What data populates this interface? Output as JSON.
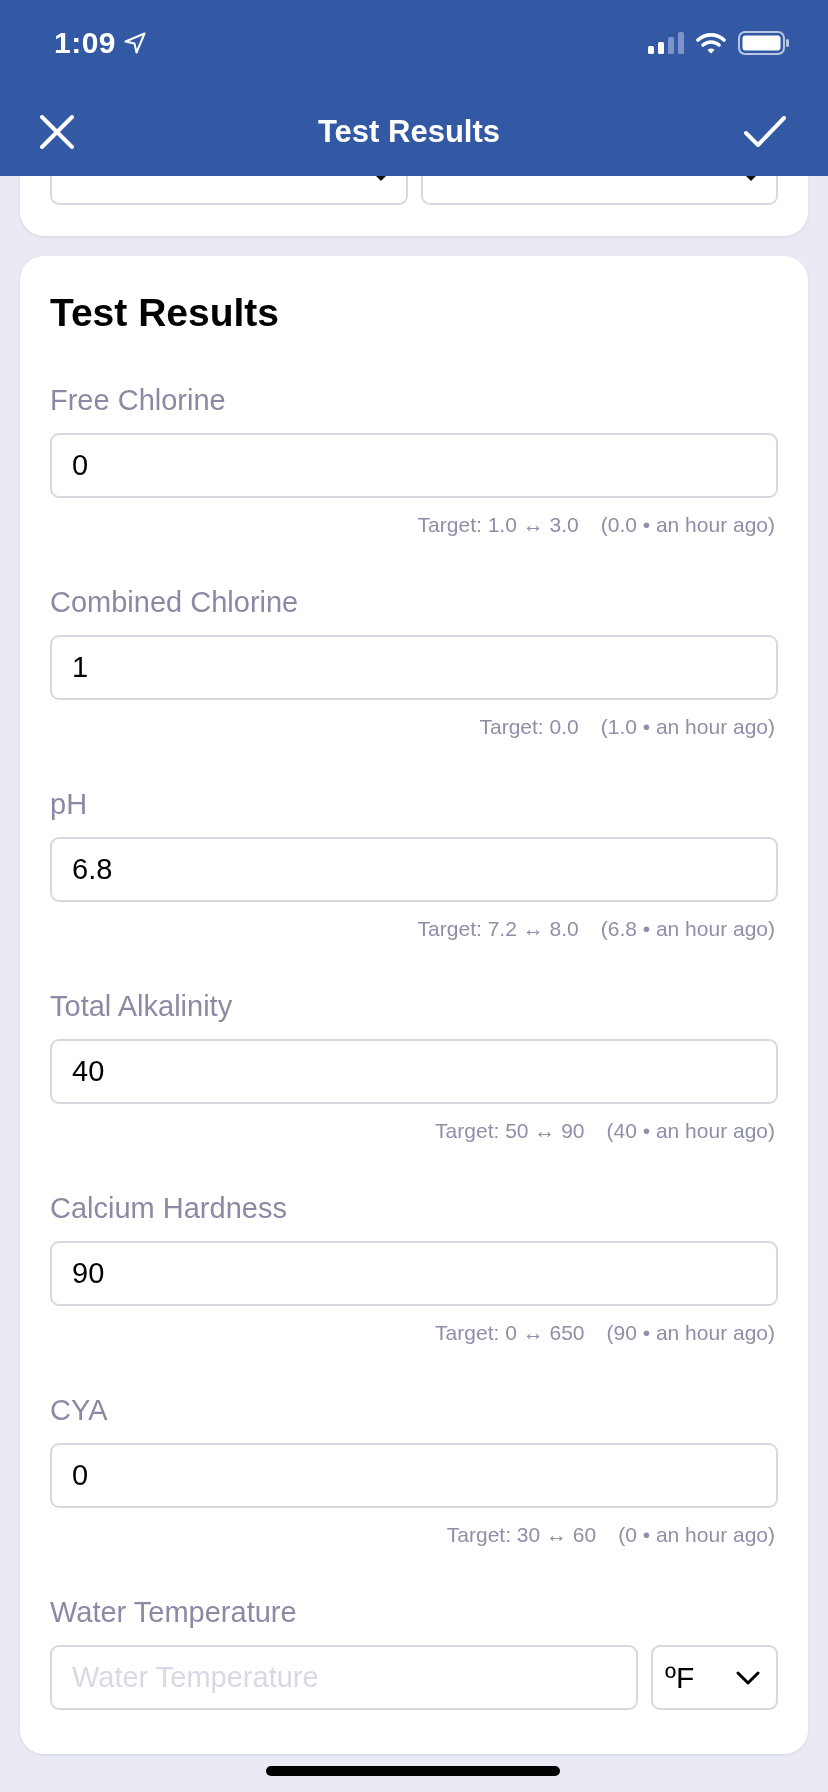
{
  "status_bar": {
    "time": "1:09"
  },
  "nav_bar": {
    "title": "Test Results"
  },
  "card": {
    "title": "Test Results",
    "fields": [
      {
        "kind": "reading",
        "label": "Free Chlorine",
        "value": "0",
        "target": "Target: 1.0 ↔ 3.0",
        "last": "(0.0 • an hour ago)"
      },
      {
        "kind": "reading",
        "label": "Combined Chlorine",
        "value": "1",
        "target": "Target: 0.0",
        "last": "(1.0 • an hour ago)"
      },
      {
        "kind": "reading",
        "label": "pH",
        "value": "6.8",
        "target": "Target: 7.2 ↔ 8.0",
        "last": "(6.8 • an hour ago)"
      },
      {
        "kind": "reading",
        "label": "Total Alkalinity",
        "value": "40",
        "target": "Target: 50 ↔ 90",
        "last": "(40 • an hour ago)"
      },
      {
        "kind": "reading",
        "label": "Calcium Hardness",
        "value": "90",
        "target": "Target: 0 ↔ 650",
        "last": "(90 • an hour ago)"
      },
      {
        "kind": "reading",
        "label": "CYA",
        "value": "0",
        "target": "Target: 30 ↔ 60",
        "last": "(0 • an hour ago)"
      },
      {
        "kind": "temperature",
        "label": "Water Temperature",
        "placeholder": "Water Temperature",
        "unit": "ºF"
      }
    ]
  }
}
